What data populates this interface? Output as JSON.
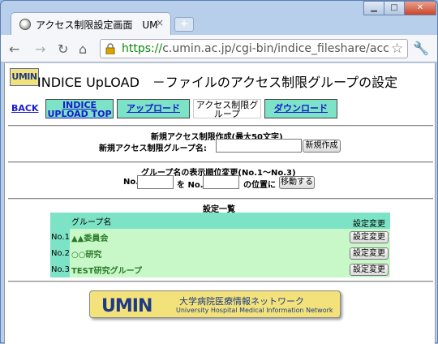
{
  "browser": {
    "tab_title": "アクセス制限設定画面　UM",
    "tab_close": "×",
    "newtab": "+",
    "url_scheme": "https://",
    "url_rest": "c.umin.ac.jp/cgi-bin/indice_fileshare/acce",
    "minimize": "▁",
    "maximize": "□",
    "close": "✕"
  },
  "page": {
    "logo": "UMIN",
    "heading": "INDICE UpLOAD　－ファイルのアクセス制限グループの設定",
    "nav": {
      "back": "BACK",
      "items": [
        {
          "label": "INDICE UPLOAD TOP"
        },
        {
          "label": "アップロード"
        },
        {
          "label": "アクセス制限グループ"
        },
        {
          "label": "ダウンロード"
        }
      ]
    },
    "create": {
      "title": "新規アクセス制限作成(最大50文字)",
      "label": "新規アクセス制限グループ名:",
      "input_value": "",
      "button": "新規作成"
    },
    "order": {
      "title": "グループ名の表示順位変更(No.1～No.3)",
      "label_no1": "No.",
      "label_wo": "を No.",
      "label_pos": "の位置に",
      "button": "移動する"
    },
    "list": {
      "title": "設定一覧",
      "header_name": "グループ名",
      "header_action": "設定変更",
      "rows": [
        {
          "num": "No.1",
          "name": "▲▲委員会",
          "action": "設定変更"
        },
        {
          "num": "No.2",
          "name": "○○研究",
          "action": "設定変更"
        },
        {
          "num": "No.3",
          "name": "TEST研究グループ",
          "action": "設定変更"
        }
      ]
    },
    "footer": {
      "logo": "UMIN",
      "jp": "大学病院医療情報ネットワーク",
      "en": "University Hospital Medical Information Network"
    }
  }
}
